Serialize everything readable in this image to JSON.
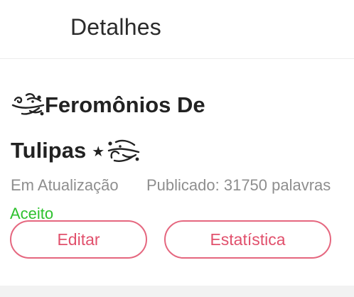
{
  "header": {
    "title": "Detalhes"
  },
  "book": {
    "title_line1": "Feromônios De",
    "title_line2": "Tulipas",
    "star": "★",
    "status": "Em Atualização",
    "published": "Publicado: 31750 palavras",
    "accepted": "Aceito"
  },
  "actions": {
    "edit_label": "Editar",
    "stats_label": "Estatística"
  },
  "colors": {
    "accent": "#e5677f",
    "accepted": "#2ec12e",
    "muted": "#8e8e8e"
  },
  "icons": {
    "ornament_left": "swirl-ornament-icon",
    "ornament_right": "swirl-ornament-icon"
  }
}
